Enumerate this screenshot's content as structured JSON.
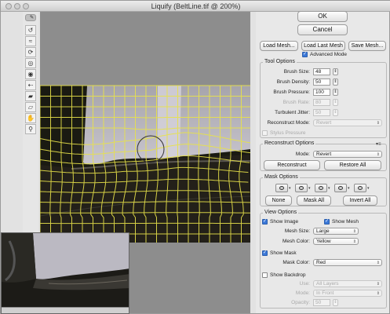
{
  "window": {
    "title": "Liquify (BeltLine.tif @ 200%)"
  },
  "toolbar": {
    "tools": [
      {
        "name": "forward-warp-tool-icon",
        "glyph": "✎"
      },
      {
        "name": "reconstruct-tool-icon",
        "glyph": "↺"
      },
      {
        "name": "smooth-tool-icon",
        "glyph": "≈"
      },
      {
        "name": "twirl-tool-icon",
        "glyph": "⟳"
      },
      {
        "name": "pucker-tool-icon",
        "glyph": "◎"
      },
      {
        "name": "bloat-tool-icon",
        "glyph": "◉"
      },
      {
        "name": "push-left-tool-icon",
        "glyph": "⇠"
      },
      {
        "name": "freeze-mask-tool-icon",
        "glyph": "▰"
      },
      {
        "name": "thaw-mask-tool-icon",
        "glyph": "▱"
      },
      {
        "name": "hand-tool-icon",
        "glyph": "✋"
      },
      {
        "name": "zoom-tool-icon",
        "glyph": "⚲"
      }
    ]
  },
  "buttons": {
    "ok": "OK",
    "cancel": "Cancel",
    "load_mesh": "Load Mesh...",
    "load_last_mesh": "Load Last Mesh",
    "save_mesh": "Save Mesh..."
  },
  "advanced_mode": {
    "label": "Advanced Mode",
    "checked": true
  },
  "tool_options": {
    "title": "Tool Options",
    "brush_size": {
      "label": "Brush Size:",
      "value": "48"
    },
    "brush_density": {
      "label": "Brush Density:",
      "value": "50"
    },
    "brush_pressure": {
      "label": "Brush Pressure:",
      "value": "100"
    },
    "brush_rate": {
      "label": "Brush Rate:",
      "value": "80"
    },
    "turbulent_jitter": {
      "label": "Turbulent Jitter:",
      "value": "50"
    },
    "reconstruct_mode": {
      "label": "Reconstruct Mode:",
      "value": "Revert"
    },
    "stylus_pressure": {
      "label": "Stylus Pressure",
      "checked": false
    }
  },
  "reconstruct_options": {
    "title": "Reconstruct Options",
    "mode_label": "Mode:",
    "mode_value": "Revert",
    "reconstruct": "Reconstruct",
    "restore_all": "Restore All"
  },
  "mask_options": {
    "title": "Mask Options",
    "none": "None",
    "mask_all": "Mask All",
    "invert_all": "Invert All"
  },
  "view_options": {
    "title": "View Options",
    "show_image": {
      "label": "Show Image",
      "checked": true
    },
    "show_mesh": {
      "label": "Show Mesh",
      "checked": true
    },
    "mesh_size": {
      "label": "Mesh Size:",
      "value": "Large"
    },
    "mesh_color": {
      "label": "Mesh Color:",
      "value": "Yellow"
    },
    "show_mask": {
      "label": "Show Mask",
      "checked": true
    },
    "mask_color": {
      "label": "Mask Color:",
      "value": "Red"
    },
    "show_backdrop": {
      "label": "Show Backdrop",
      "checked": false
    },
    "use": {
      "label": "Use:",
      "value": "All Layers"
    },
    "mode": {
      "label": "Mode:",
      "value": "In Front"
    },
    "opacity": {
      "label": "Opacity:",
      "value": "50"
    }
  },
  "colors": {
    "mesh": "#e8e24a",
    "accent": "#3b78d8"
  }
}
